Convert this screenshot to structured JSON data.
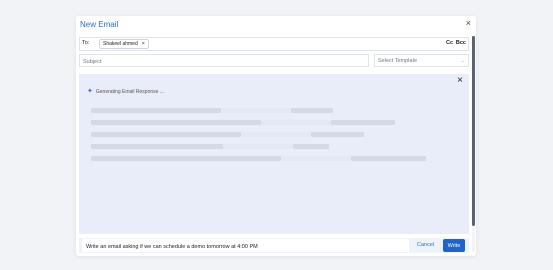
{
  "dialog": {
    "title": "New Email"
  },
  "recipients": {
    "to_label": "To:",
    "chips": [
      {
        "name": "Shakeel ahmed"
      }
    ],
    "cc_label": "Cc",
    "bcc_label": "Bcc"
  },
  "subject": {
    "placeholder": "Subject",
    "value": ""
  },
  "template_select": {
    "placeholder": "Select Template"
  },
  "generation": {
    "status": "Generating Email Response ..."
  },
  "prompt": {
    "value": "Write an email asking if we can schedule a demo tomorrow at 4:00 PM",
    "cancel_label": "Cancel",
    "write_label": "Write"
  },
  "icons": {
    "close": "close-icon",
    "sparkle": "sparkle-icon",
    "chip_remove": "remove-icon",
    "dropdown": "chevron-down-icon"
  },
  "colors": {
    "accent": "#2f6fc4",
    "panel_bg": "#e8edf9",
    "write_button": "#1f64c8"
  }
}
